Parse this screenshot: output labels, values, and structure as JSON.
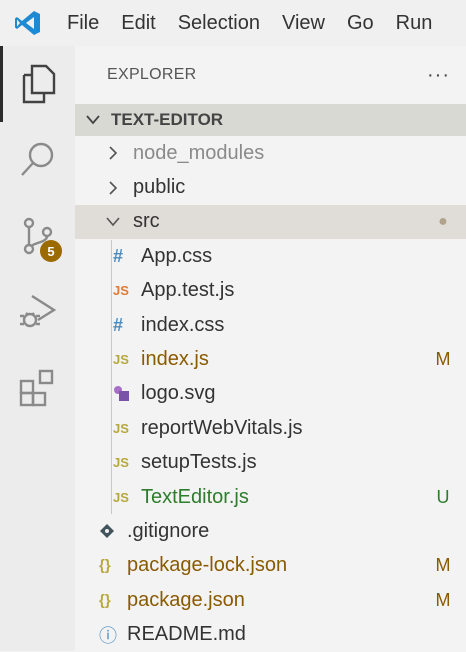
{
  "menubar": {
    "items": [
      "File",
      "Edit",
      "Selection",
      "View",
      "Go",
      "Run"
    ]
  },
  "activity_bar": {
    "scm_badge": "5"
  },
  "explorer": {
    "title": "EXPLORER",
    "more": "···"
  },
  "project": {
    "name": "TEXT-EDITOR"
  },
  "tree": [
    {
      "name": "node_modules",
      "status": "",
      "name_color": "#8a8a8a",
      "status_color": ""
    },
    {
      "name": "public",
      "status": "",
      "name_color": "#333333",
      "status_color": ""
    },
    {
      "name": "src",
      "status": "●",
      "name_color": "#333333",
      "status_color": "#b0a28d"
    },
    {
      "name": "App.css",
      "icon_text": "#",
      "icon_color": "#4b8bbe",
      "status": "",
      "name_color": "#333333",
      "status_color": ""
    },
    {
      "name": "App.test.js",
      "icon_text": "JS",
      "icon_color": "#e37933",
      "status": "",
      "name_color": "#333333",
      "status_color": ""
    },
    {
      "name": "index.css",
      "icon_text": "#",
      "icon_color": "#4b8bbe",
      "status": "",
      "name_color": "#333333",
      "status_color": ""
    },
    {
      "name": "index.js",
      "icon_text": "JS",
      "icon_color": "#b7a83e",
      "status": "M",
      "name_color": "#8a5a00",
      "status_color": "#8a5a00"
    },
    {
      "name": "logo.svg",
      "icon_text": "",
      "icon_color": "#a86fc9",
      "status": "",
      "name_color": "#333333",
      "status_color": ""
    },
    {
      "name": "reportWebVitals.js",
      "icon_text": "JS",
      "icon_color": "#b7a83e",
      "status": "",
      "name_color": "#333333",
      "status_color": ""
    },
    {
      "name": "setupTests.js",
      "icon_text": "JS",
      "icon_color": "#b7a83e",
      "status": "",
      "name_color": "#333333",
      "status_color": ""
    },
    {
      "name": "TextEditor.js",
      "icon_text": "JS",
      "icon_color": "#b7a83e",
      "status": "U",
      "name_color": "#2d7d2d",
      "status_color": "#2d7d2d"
    },
    {
      "name": ".gitignore",
      "icon_text": "",
      "icon_color": "#41535b",
      "status": "",
      "name_color": "#333333",
      "status_color": ""
    },
    {
      "name": "package-lock.json",
      "icon_text": "{}",
      "icon_color": "#b7a83e",
      "status": "M",
      "name_color": "#8a5a00",
      "status_color": "#8a5a00"
    },
    {
      "name": "package.json",
      "icon_text": "{}",
      "icon_color": "#b7a83e",
      "status": "M",
      "name_color": "#8a5a00",
      "status_color": "#8a5a00"
    },
    {
      "name": "README.md",
      "icon_text": "ⓘ",
      "icon_color": "#4b8bbe",
      "status": "",
      "name_color": "#333333",
      "status_color": ""
    }
  ]
}
